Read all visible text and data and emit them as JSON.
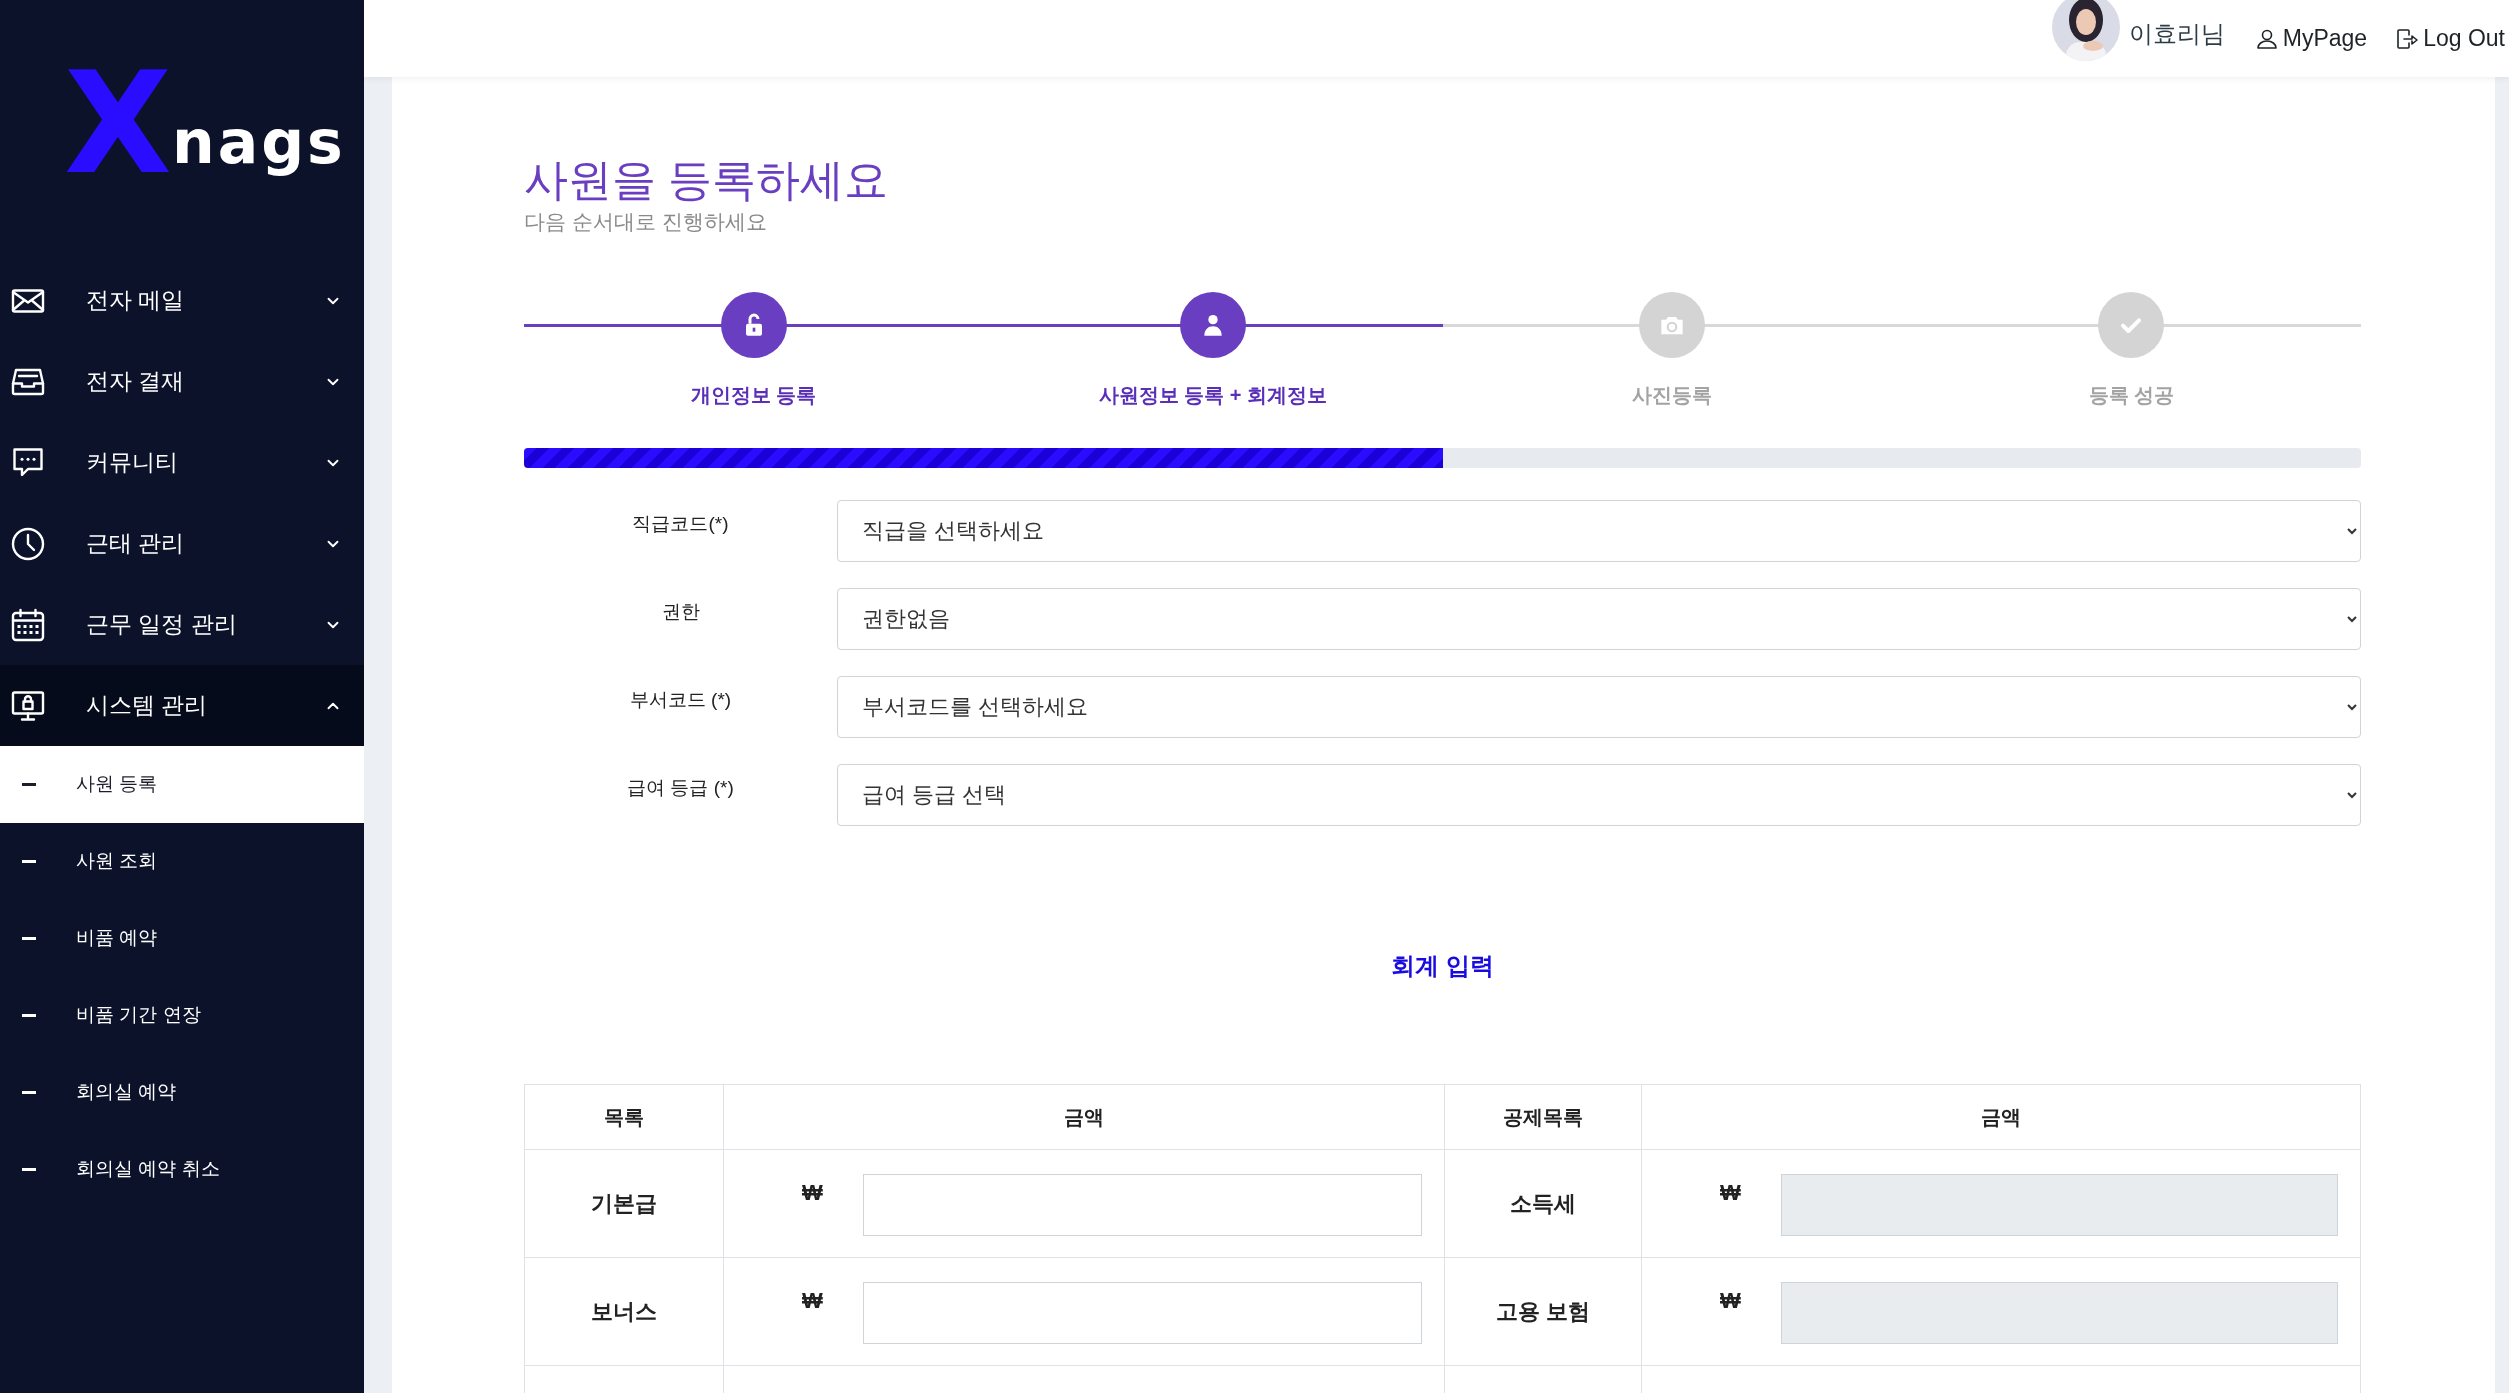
{
  "logo": {
    "mark": "X",
    "text": "nags"
  },
  "sidebar": {
    "items": [
      {
        "kind": "mail",
        "label": "전자 메일",
        "expanded": false
      },
      {
        "kind": "tray",
        "label": "전자 결재",
        "expanded": false
      },
      {
        "kind": "chat",
        "label": "커뮤니티",
        "expanded": false
      },
      {
        "kind": "clock",
        "label": "근태 관리",
        "expanded": false
      },
      {
        "kind": "calendar",
        "label": "근무 일정 관리",
        "expanded": false
      },
      {
        "kind": "monitor",
        "label": "시스템 관리",
        "expanded": true,
        "children": [
          {
            "label": "사원 등록",
            "selected": true
          },
          {
            "label": "사원 조회",
            "selected": false
          },
          {
            "label": "비품 예약",
            "selected": false
          },
          {
            "label": "비품 기간 연장",
            "selected": false
          },
          {
            "label": "회의실 예약",
            "selected": false
          },
          {
            "label": "회의실 예약 취소",
            "selected": false
          }
        ]
      }
    ]
  },
  "header": {
    "user": "이효리님",
    "links": [
      {
        "kind": "user",
        "label": "MyPage"
      },
      {
        "kind": "logout",
        "label": "Log Out"
      }
    ]
  },
  "title": "사원을 등록하세요",
  "subtitle": "다음 순서대로 진행하세요",
  "steps": [
    {
      "kind": "unlock",
      "label": "개인정보 등록",
      "completed": true
    },
    {
      "kind": "user",
      "label": "사원정보 등록 + 회계정보",
      "completed": true
    },
    {
      "kind": "camera",
      "label": "사진등록",
      "completed": false
    },
    {
      "kind": "check",
      "label": "등록 성공",
      "completed": false
    }
  ],
  "progress": {
    "level": 0.5
  },
  "form": [
    {
      "label": "직급코드(*)",
      "value": "직급을 선택하세요"
    },
    {
      "label": "권한",
      "value": "권한없음"
    },
    {
      "label": "부서코드 (*)",
      "value": "부서코드를 선택하세요"
    },
    {
      "label": "급여 등급 (*)",
      "value": "급여 등급 선택"
    }
  ],
  "section_title": "회계 입력",
  "table": {
    "columns": [
      "목록",
      "금액",
      "공제목록",
      "금액"
    ],
    "rows": [
      {
        "item": "기본급",
        "currency": "₩",
        "item_disabled": false,
        "deduction": "소득세",
        "deduction_currency": "₩",
        "deduction_disabled": true
      },
      {
        "item": "보너스",
        "currency": "₩",
        "item_disabled": false,
        "deduction": "고용 보험",
        "deduction_currency": "₩",
        "deduction_disabled": true
      }
    ]
  }
}
